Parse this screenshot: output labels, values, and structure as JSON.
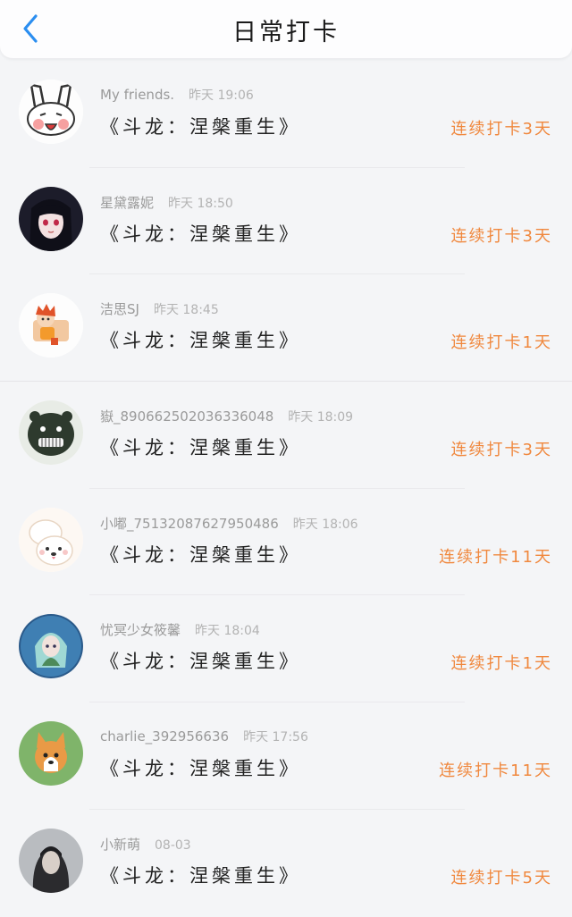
{
  "header": {
    "title": "日常打卡",
    "back_icon": "chevron-left-icon",
    "accent": "#2b8ef0"
  },
  "streak_color": "#f0883e",
  "entries": [
    {
      "user": "My friends.",
      "time": "昨天 19:06",
      "book": "《斗龙：涅槃重生》",
      "streak": "连续打卡3天",
      "avatar": "bunny-avatar"
    },
    {
      "user": "星黛露妮",
      "time": "昨天 18:50",
      "book": "《斗龙：涅槃重生》",
      "streak": "连续打卡3天",
      "avatar": "anime-girl-avatar"
    },
    {
      "user": "洁思SJ",
      "time": "昨天 18:45",
      "book": "《斗龙：涅槃重生》",
      "streak": "连续打卡1天",
      "avatar": "cartoon-boy-avatar"
    },
    {
      "user": "嶽_890662502036336048",
      "time": "昨天 18:09",
      "book": "《斗龙：涅槃重生》",
      "streak": "连续打卡3天",
      "avatar": "grinning-blob-avatar"
    },
    {
      "user": "小嘟_75132087627950486",
      "time": "昨天 18:06",
      "book": "《斗龙：涅槃重生》",
      "streak": "连续打卡11天",
      "avatar": "puppy-avatar"
    },
    {
      "user": "忧冥少女筱馨",
      "time": "昨天 18:04",
      "book": "《斗龙：涅槃重生》",
      "streak": "连续打卡1天",
      "avatar": "fairy-avatar"
    },
    {
      "user": "charlie_392956636",
      "time": "昨天 17:56",
      "book": "《斗龙：涅槃重生》",
      "streak": "连续打卡11天",
      "avatar": "corgi-avatar"
    },
    {
      "user": "小新萌",
      "time": "08-03",
      "book": "《斗龙：涅槃重生》",
      "streak": "连续打卡5天",
      "avatar": "girl-photo-avatar"
    }
  ]
}
